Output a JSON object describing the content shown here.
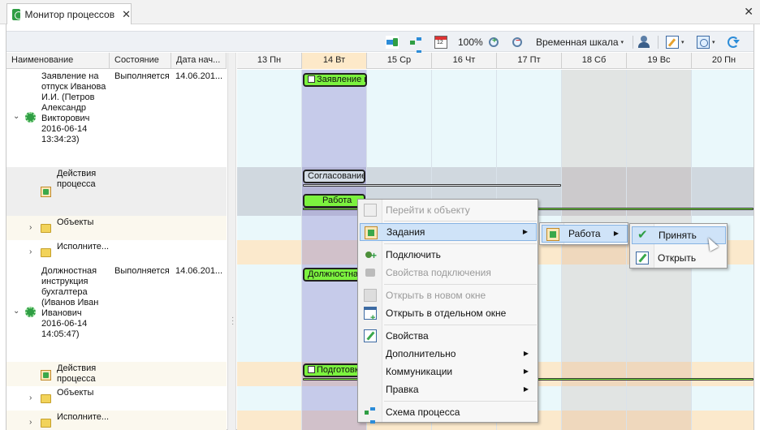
{
  "window": {
    "tab_title": "Монитор процессов",
    "tab_close": "✕",
    "close": "✕"
  },
  "toolbar": {
    "zoom": "100%",
    "timescale": "Временная шкала",
    "dropdown_arrow": "▾"
  },
  "grid": {
    "columns": [
      "Наименование",
      "Состояние",
      "Дата нач..."
    ],
    "rows": [
      {
        "name_lines": [
          "Заявление на",
          "отпуск Иванова",
          "И.И. (Петров",
          "Александр",
          "Викторович",
          "2016-06-14",
          "13:34:23)"
        ],
        "status": "Выполняется",
        "date": "14.06.201..."
      },
      {
        "name_lines": [
          "Действия",
          "процесса"
        ]
      },
      {
        "name": "Объекты"
      },
      {
        "name": "Исполните..."
      },
      {
        "name_lines": [
          "Должностная",
          "инструкция",
          "бухгалтера",
          "(Иванов Иван",
          "Иванович",
          "2016-06-14",
          "14:05:47)"
        ],
        "status": "Выполняется",
        "date": "14.06.201..."
      },
      {
        "name_lines": [
          "Действия",
          "процесса"
        ]
      },
      {
        "name": "Объекты"
      },
      {
        "name": "Исполните..."
      }
    ]
  },
  "gantt": {
    "days": [
      "13 Пн",
      "14 Вт",
      "15 Ср",
      "16 Чт",
      "17 Пт",
      "18 Сб",
      "19 Вс",
      "20 Пн"
    ],
    "bars": {
      "b1": "Заявление н...",
      "b2": "Согласование",
      "b3": "Работа",
      "b4": "Должностна...",
      "b5": "Подготовка"
    }
  },
  "context_menu": {
    "items": [
      {
        "label": "Перейти к объекту",
        "disabled": true
      },
      {
        "label": "Задания",
        "submenu": true
      },
      {
        "label": "Подключить"
      },
      {
        "label": "Свойства подключения",
        "disabled": true
      },
      {
        "label": "Открыть в новом окне",
        "disabled": true
      },
      {
        "label": "Открыть в отдельном окне"
      },
      {
        "label": "Свойства"
      },
      {
        "label": "Дополнительно",
        "submenu": true
      },
      {
        "label": "Коммуникации",
        "submenu": true
      },
      {
        "label": "Правка",
        "submenu": true
      },
      {
        "label": "Схема процесса"
      }
    ],
    "submenu_1": {
      "label": "Работа"
    },
    "submenu_2": [
      {
        "label": "Принять"
      },
      {
        "label": "Открыть"
      }
    ],
    "arrow": "▶"
  },
  "colors": {
    "accent_green": "#7cf23f",
    "selection_blue": "#cfe3f8",
    "today_column": "#c9c9e6",
    "weekend_column": "#f1e6df"
  }
}
